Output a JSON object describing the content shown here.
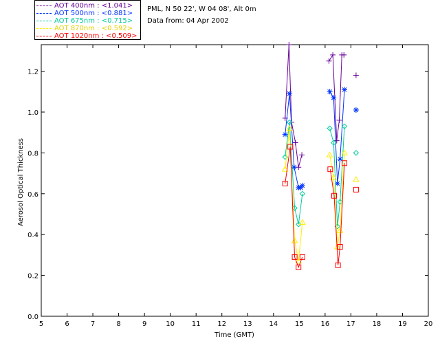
{
  "chart_data": {
    "type": "line",
    "xlabel": "Time (GMT)",
    "ylabel": "Aerosol Optical Thickness",
    "xlim": [
      5,
      20
    ],
    "ylim": [
      0,
      1.33
    ],
    "xticks": [
      "5",
      "6",
      "7",
      "8",
      "9",
      "10",
      "11",
      "12",
      "13",
      "14",
      "15",
      "16",
      "17",
      "18",
      "19",
      "20"
    ],
    "yticks": [
      "0.0",
      "0.2",
      "0.4",
      "0.6",
      "0.8",
      "1.0",
      "1.2"
    ],
    "info_line1": "PML, N 50 22', W 04 08', Alt 0m",
    "info_line2": "Data from: 04 Apr 2002",
    "series": [
      {
        "name": "AOT  400nm : <1.041>",
        "color": "#660099",
        "marker": "plus",
        "x": [
          14.45,
          14.6,
          14.7,
          14.85,
          14.97,
          15.1,
          null,
          16.15,
          16.3,
          16.45,
          16.55,
          16.65,
          16.73,
          17.2
        ],
        "y": [
          0.97,
          1.33,
          0.95,
          0.85,
          0.73,
          0.79,
          null,
          1.25,
          1.28,
          0.86,
          0.96,
          1.28,
          1.28,
          1.18
        ]
      },
      {
        "name": "AOT  500nm : <0.881>",
        "color": "#0033ff",
        "marker": "asterisk",
        "x": [
          14.45,
          14.62,
          14.8,
          14.97,
          15.05,
          15.12,
          null,
          16.18,
          16.33,
          16.48,
          16.58,
          16.75,
          17.2
        ],
        "y": [
          0.89,
          1.09,
          0.73,
          0.63,
          0.63,
          0.64,
          null,
          1.1,
          1.07,
          0.65,
          0.77,
          1.11,
          1.01
        ]
      },
      {
        "name": "AOT  675nm : <0.715>",
        "color": "#00cc99",
        "marker": "diamond",
        "x": [
          14.45,
          14.62,
          14.82,
          14.97,
          15.12,
          null,
          16.18,
          16.33,
          16.48,
          16.58,
          16.75,
          17.2
        ],
        "y": [
          0.78,
          0.95,
          0.53,
          0.45,
          0.6,
          null,
          0.92,
          0.85,
          0.44,
          0.56,
          0.93,
          0.8
        ]
      },
      {
        "name": "AOT  870nm : <0.592>",
        "color": "#ffee00",
        "marker": "triangle",
        "x": [
          14.45,
          14.62,
          14.82,
          14.97,
          15.12,
          null,
          16.18,
          16.33,
          16.48,
          16.58,
          16.75,
          17.2
        ],
        "y": [
          0.72,
          0.92,
          0.37,
          0.27,
          0.46,
          null,
          0.79,
          0.68,
          0.34,
          0.42,
          0.8,
          0.67
        ]
      },
      {
        "name": "AOT 1020nm : <0.509>",
        "color": "#ff0000",
        "marker": "square",
        "x": [
          14.45,
          14.65,
          14.82,
          14.97,
          15.12,
          null,
          16.2,
          16.35,
          16.5,
          16.58,
          16.75,
          17.2
        ],
        "y": [
          0.65,
          0.83,
          0.29,
          0.24,
          0.29,
          null,
          0.72,
          0.59,
          0.25,
          0.34,
          0.75,
          0.62
        ]
      }
    ]
  }
}
